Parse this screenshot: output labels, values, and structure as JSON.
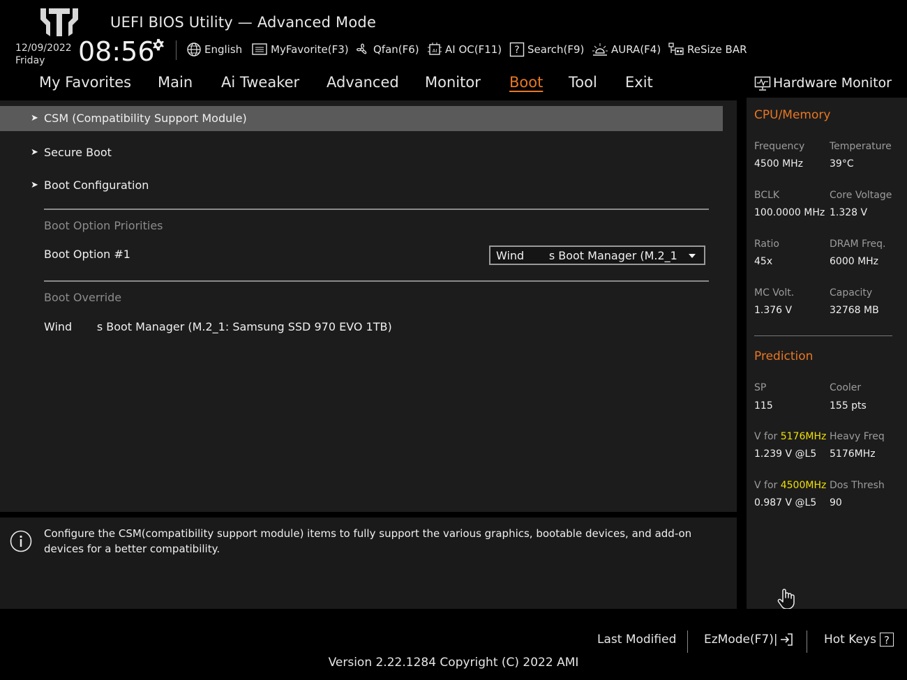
{
  "header": {
    "title": "UEFI BIOS Utility — Advanced Mode",
    "date": "12/09/2022",
    "day": "Friday",
    "time": "08:56"
  },
  "toolbar": {
    "items": [
      {
        "label": "English",
        "icon": "globe-icon"
      },
      {
        "label": "MyFavorite(F3)",
        "icon": "favorite-list-icon"
      },
      {
        "label": "Qfan(F6)",
        "icon": "fan-icon"
      },
      {
        "label": "AI OC(F11)",
        "icon": "chip-icon"
      },
      {
        "label": "Search(F9)",
        "icon": "question-box-icon"
      },
      {
        "label": "AURA(F4)",
        "icon": "light-icon"
      },
      {
        "label": "ReSize BAR",
        "icon": "resize-bar-icon"
      }
    ]
  },
  "nav": {
    "tabs": [
      "My Favorites",
      "Main",
      "Ai Tweaker",
      "Advanced",
      "Monitor",
      "Boot",
      "Tool",
      "Exit"
    ],
    "active": "Boot"
  },
  "boot": {
    "items": [
      "CSM (Compatibility Support Module)",
      "Secure Boot",
      "Boot Configuration"
    ],
    "priorities_label": "Boot Option Priorities",
    "option1_label": "Boot Option #1",
    "option1_value": "Wind       s Boot Manager (M.2_1",
    "override_label": "Boot Override",
    "override_item": "Wind       s Boot Manager (M.2_1: Samsung SSD 970 EVO 1TB)"
  },
  "info": {
    "text": "Configure the CSM(compatibility support module) items to fully support the various graphics, bootable devices, and add-on devices for a better compatibility."
  },
  "hw": {
    "title": "Hardware Monitor",
    "cpu_section": "CPU/Memory",
    "freq_label": "Frequency",
    "freq_value": "4500 MHz",
    "temp_label": "Temperature",
    "temp_value": "39°C",
    "bclk_label": "BCLK",
    "bclk_value": "100.0000 MHz",
    "corev_label": "Core Voltage",
    "corev_value": "1.328 V",
    "ratio_label": "Ratio",
    "ratio_value": "45x",
    "dram_label": "DRAM Freq.",
    "dram_value": "6000 MHz",
    "mcv_label": "MC Volt.",
    "mcv_value": "1.376 V",
    "cap_label": "Capacity",
    "cap_value": "32768 MB",
    "pred_section": "Prediction",
    "sp_label": "SP",
    "sp_value": "115",
    "cooler_label": "Cooler",
    "cooler_value": "155 pts",
    "vfor_prefix": "V for ",
    "vfor1_freq": "5176MHz",
    "vfor1_value": "1.239 V @L5",
    "heavy_label": "Heavy Freq",
    "heavy_value": "5176MHz",
    "vfor2_freq": "4500MHz",
    "vfor2_value": "0.987 V @L5",
    "dos_label": "Dos Thresh",
    "dos_value": "90"
  },
  "footer": {
    "last_modified": "Last Modified",
    "ezmode": "EzMode(F7)|",
    "hotkeys": "Hot Keys",
    "hotkeys_glyph": "?",
    "version": "Version 2.22.1284 Copyright (C) 2022 AMI"
  },
  "colors": {
    "accent": "#e87722",
    "highlight": "#f0e000",
    "selected_row": "#5a5a5a"
  }
}
